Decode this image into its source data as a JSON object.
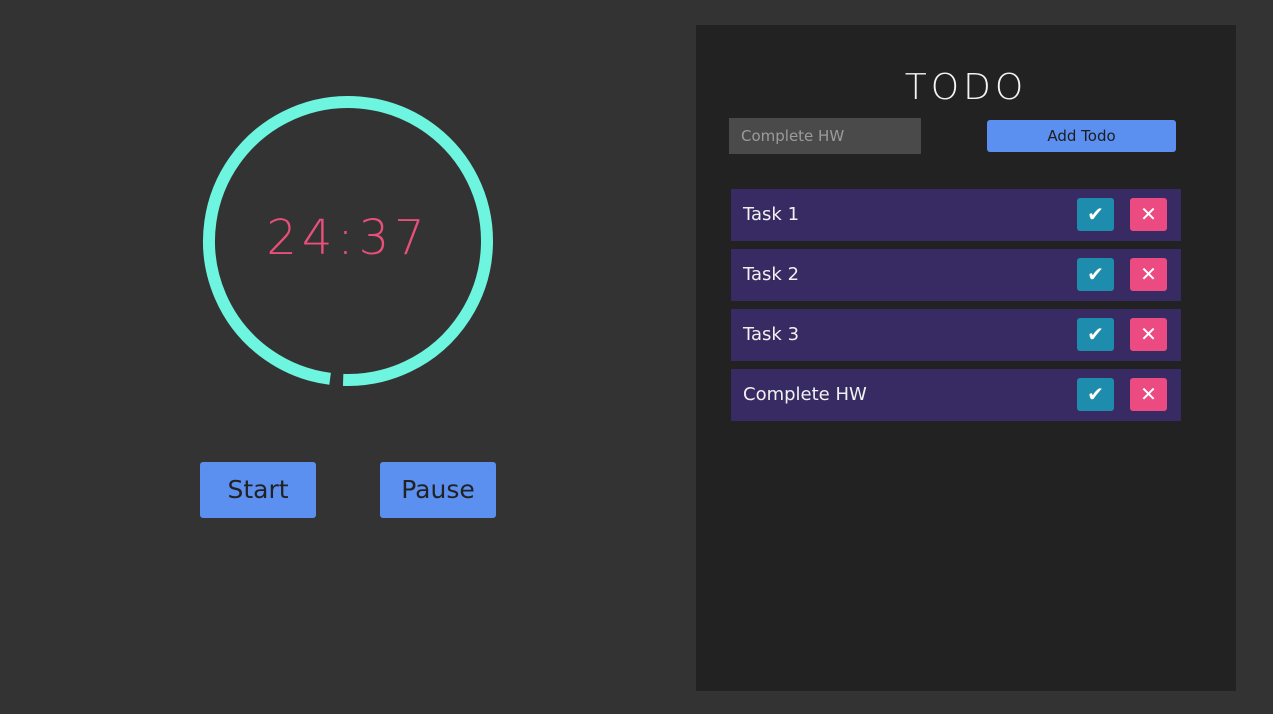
{
  "theme": {
    "background": "#333333",
    "panel_background": "#222222",
    "ring_color": "#6ef5df",
    "time_color": "#e8507a",
    "accent_blue": "#5b8ff0",
    "task_row_color": "#382b63",
    "done_button_color": "#1d8cad",
    "delete_button_color": "#ec4b82"
  },
  "timer": {
    "display": "24:37",
    "progress": 0.985,
    "start_label": "Start",
    "pause_label": "Pause"
  },
  "todo": {
    "title": "TODO",
    "input_value": "",
    "input_placeholder": "Complete HW",
    "add_label": "Add Todo",
    "items": [
      {
        "text": "Task 1",
        "done_icon": "check-icon",
        "delete_icon": "close-icon",
        "done_glyph": "✔",
        "delete_glyph": "✕"
      },
      {
        "text": "Task 2",
        "done_icon": "check-icon",
        "delete_icon": "close-icon",
        "done_glyph": "✔",
        "delete_glyph": "✕"
      },
      {
        "text": "Task 3",
        "done_icon": "check-icon",
        "delete_icon": "close-icon",
        "done_glyph": "✔",
        "delete_glyph": "✕"
      },
      {
        "text": "Complete HW",
        "done_icon": "check-icon",
        "delete_icon": "close-icon",
        "done_glyph": "✔",
        "delete_glyph": "✕"
      }
    ]
  }
}
